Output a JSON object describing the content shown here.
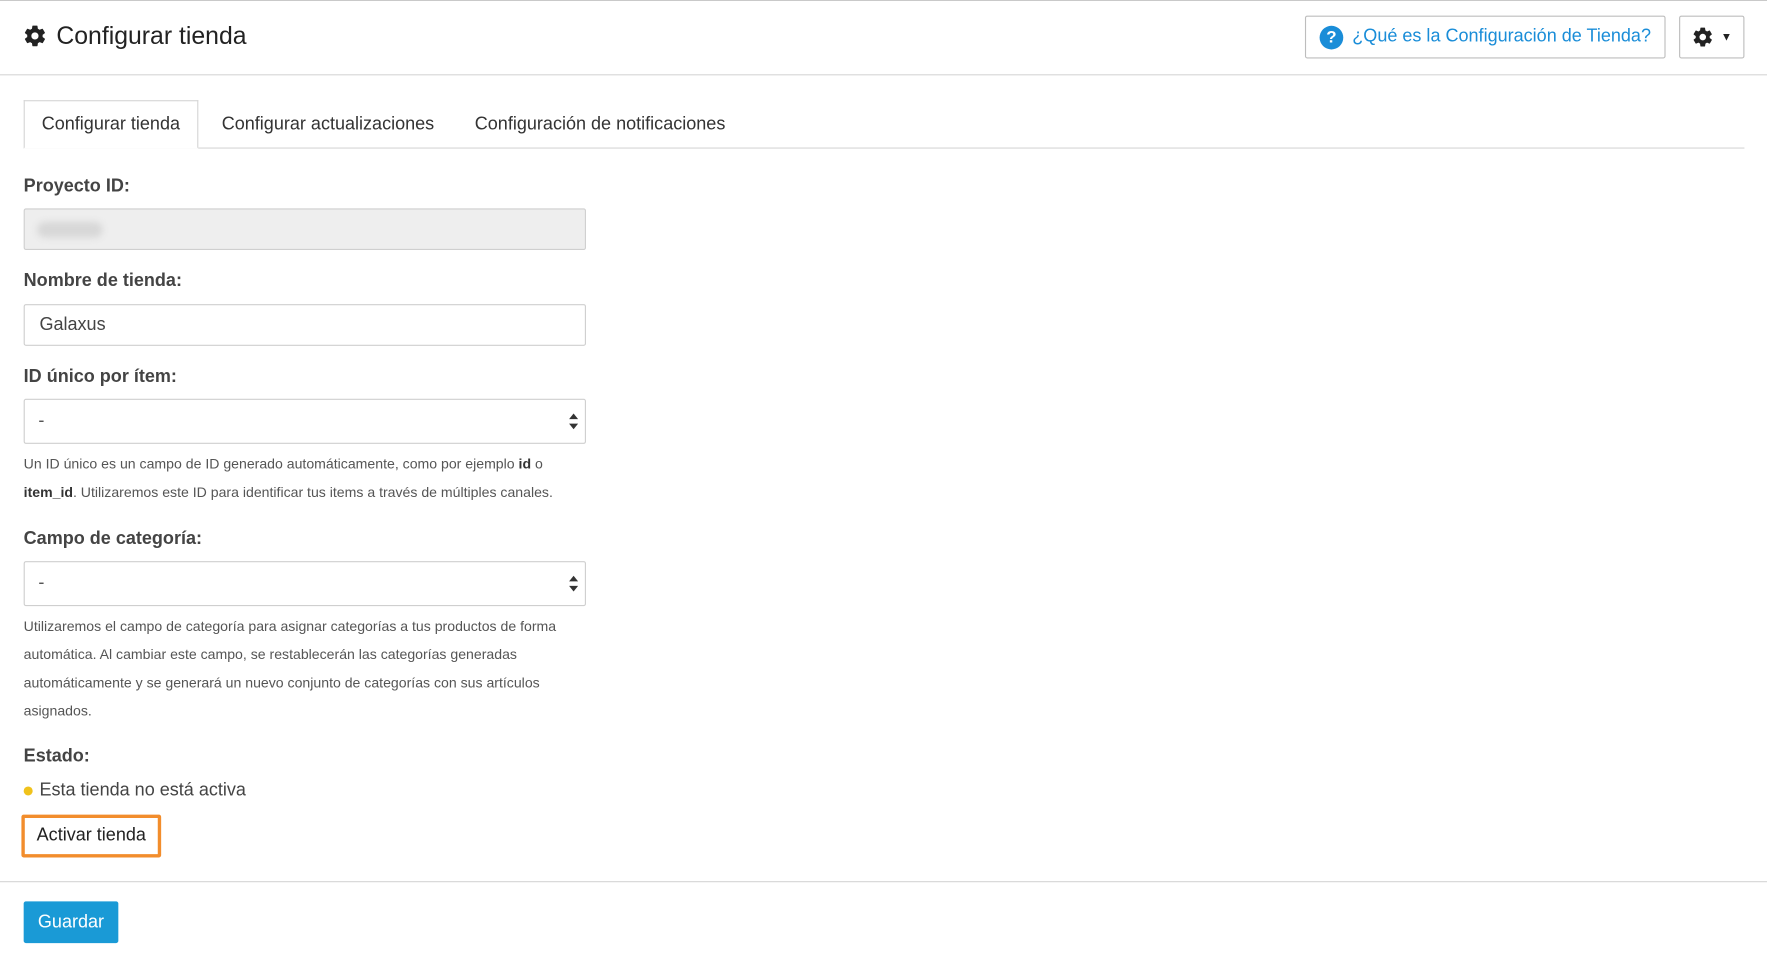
{
  "header": {
    "title": "Configurar tienda",
    "help_link": "¿Qué es la Configuración de Tienda?"
  },
  "tabs": [
    {
      "label": "Configurar tienda",
      "active": true
    },
    {
      "label": "Configurar actualizaciones",
      "active": false
    },
    {
      "label": "Configuración de notificaciones",
      "active": false
    }
  ],
  "form": {
    "project_id_label": "Proyecto ID:",
    "project_id_value": "",
    "store_name_label": "Nombre de tienda:",
    "store_name_value": "Galaxus",
    "unique_id_label": "ID único por ítem:",
    "unique_id_value": "-",
    "unique_id_help": {
      "part1": "Un ID único es un campo de ID generado automáticamente, como por ejemplo ",
      "bold1": "id",
      "part2": " o ",
      "bold2": "item_id",
      "part3": ". Utilizaremos este ID para identificar tus items a través de múltiples canales."
    },
    "category_label": "Campo de categoría:",
    "category_value": "-",
    "category_help": "Utilizaremos el campo de categoría para asignar categorías a tus productos de forma automática. Al cambiar este campo, se restablecerán las categorías generadas automáticamente y se generará un nuevo conjunto de categorías con sus artículos asignados.",
    "status_label": "Estado:",
    "status_text": "Esta tienda no está activa",
    "status_color": "#f0c21b",
    "activate_button": "Activar tienda",
    "save_button": "Guardar"
  },
  "colors": {
    "accent": "#1a9ad6",
    "link": "#1a8dd8",
    "highlight": "#f28d2c"
  }
}
